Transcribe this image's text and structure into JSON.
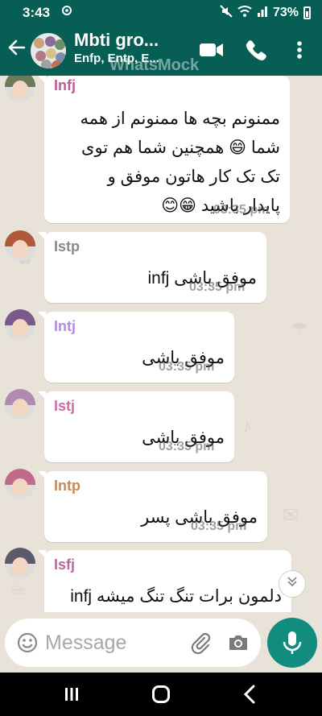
{
  "status_bar": {
    "time": "3:43",
    "battery": "73%"
  },
  "header": {
    "title": "Mbti gro...",
    "subtitle": "Enfp, Entp, E...",
    "watermark": "WhatsMock"
  },
  "messages": [
    {
      "sender": "Infj",
      "sender_color": "#c0589a",
      "lines": [
        "ممنونم بچه ها ممنونم از همه",
        "شما 😄 همچنین شما هم توی",
        "تک تک کار هاتون موفق و",
        "پایدار باشید 😁😊"
      ],
      "time": "03:35 pm"
    },
    {
      "sender": "Istp",
      "sender_color": "#8a8a8a",
      "lines": [
        "موفق باشی infj"
      ],
      "time": "03:35 pm"
    },
    {
      "sender": "Intj",
      "sender_color": "#b58be0",
      "lines": [
        "موفق باشی"
      ],
      "time": "03:35 pm"
    },
    {
      "sender": "Istj",
      "sender_color": "#d06aa8",
      "lines": [
        "موفق باشی"
      ],
      "time": "03:35 pm"
    },
    {
      "sender": "Intp",
      "sender_color": "#c48a5a",
      "lines": [
        "موفق باشی پسر"
      ],
      "time": "03:35 pm"
    },
    {
      "sender": "Isfj",
      "sender_color": "#b86a9a",
      "lines": [
        "دلمون برات تنگ تنگ میشه infj"
      ],
      "time": ""
    }
  ],
  "composer": {
    "placeholder": "Message"
  },
  "colors": {
    "header": "#075E54",
    "fab": "#128C7E",
    "chat_bg": "#e9e2d8"
  }
}
